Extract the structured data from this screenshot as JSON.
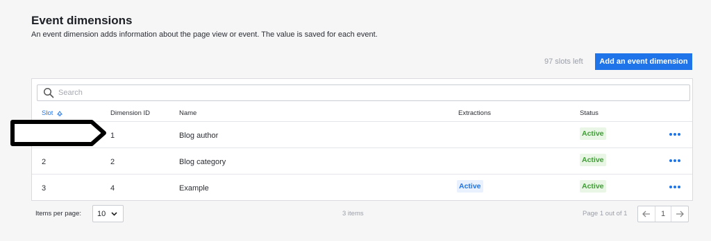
{
  "header": {
    "title": "Event dimensions",
    "subtitle": "An event dimension adds information about the page view or event. The value is saved for each event."
  },
  "toolbar": {
    "slots_left": "97 slots left",
    "add_button": "Add an event dimension"
  },
  "search": {
    "placeholder": "Search",
    "value": ""
  },
  "table": {
    "columns": [
      "Slot",
      "Dimension ID",
      "Name",
      "Extractions",
      "Status"
    ],
    "sort_indicator": "ascending",
    "rows": [
      {
        "slot": "",
        "dimension_id": "1",
        "name": "Blog author",
        "extractions": "",
        "status": "Active"
      },
      {
        "slot": "2",
        "dimension_id": "2",
        "name": "Blog category",
        "extractions": "",
        "status": "Active"
      },
      {
        "slot": "3",
        "dimension_id": "4",
        "name": "Example",
        "extractions": "Active",
        "status": "Active"
      }
    ]
  },
  "footer": {
    "items_per_page_label": "Items per page:",
    "items_per_page_value": "10",
    "items_count": "3 items",
    "page_info": "Page 1 out of 1",
    "current_page": "1"
  },
  "colors": {
    "accent": "#1e74e8",
    "status_green": "#3f9c35",
    "status_green_bg": "#e9f6e6"
  },
  "icons": [
    "search-icon",
    "sort-ascending-icon",
    "more-options-icon",
    "chevron-down-icon",
    "arrow-left-icon",
    "arrow-right-icon"
  ]
}
